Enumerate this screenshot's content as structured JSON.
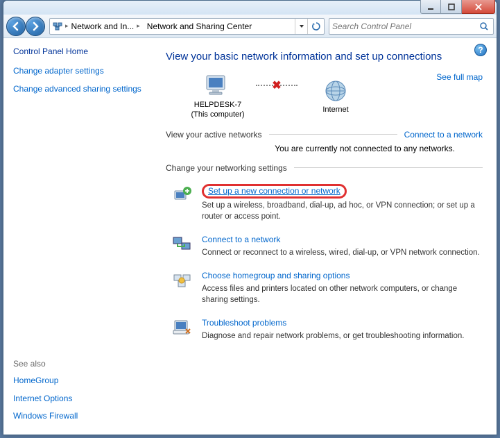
{
  "breadcrumb": {
    "item1": "Network and In...",
    "item2": "Network and Sharing Center"
  },
  "search": {
    "placeholder": "Search Control Panel"
  },
  "sidebar": {
    "home": "Control Panel Home",
    "links": [
      "Change adapter settings",
      "Change advanced sharing settings"
    ],
    "seealso_label": "See also",
    "seealso": [
      "HomeGroup",
      "Internet Options",
      "Windows Firewall"
    ]
  },
  "main": {
    "title": "View your basic network information and set up connections",
    "see_full_map": "See full map",
    "node1_name": "HELPDESK-7",
    "node1_sub": "(This computer)",
    "node2_name": "Internet",
    "active_label": "View your active networks",
    "connect_link": "Connect to a network",
    "no_connection": "You are currently not connected to any networks.",
    "change_label": "Change your networking settings",
    "settings": [
      {
        "title": "Set up a new connection or network",
        "desc": "Set up a wireless, broadband, dial-up, ad hoc, or VPN connection; or set up a router or access point."
      },
      {
        "title": "Connect to a network",
        "desc": "Connect or reconnect to a wireless, wired, dial-up, or VPN network connection."
      },
      {
        "title": "Choose homegroup and sharing options",
        "desc": "Access files and printers located on other network computers, or change sharing settings."
      },
      {
        "title": "Troubleshoot problems",
        "desc": "Diagnose and repair network problems, or get troubleshooting information."
      }
    ]
  },
  "help_glyph": "?"
}
